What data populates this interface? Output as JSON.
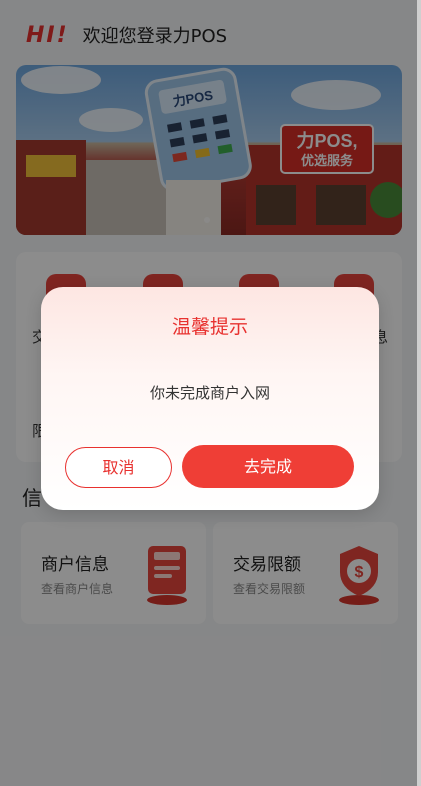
{
  "header": {
    "hi": "HI!",
    "welcome": "欢迎您登录力POS"
  },
  "banner": {
    "terminal_text": "力POS",
    "sign_line1": "力POS,",
    "sign_line2": "优选服务"
  },
  "menu": {
    "label_left_top": "交",
    "label_right_top": "息",
    "label_left_bottom": "限"
  },
  "info_section": {
    "title": "信",
    "cards": [
      {
        "title": "商户信息",
        "subtitle": "查看商户信息"
      },
      {
        "title": "交易限额",
        "subtitle": "查看交易限额"
      }
    ]
  },
  "dialog": {
    "title": "温馨提示",
    "message": "你未完成商户入网",
    "cancel_label": "取消",
    "confirm_label": "去完成"
  },
  "colors": {
    "accent": "#e8312f",
    "confirm": "#ef3e36"
  }
}
